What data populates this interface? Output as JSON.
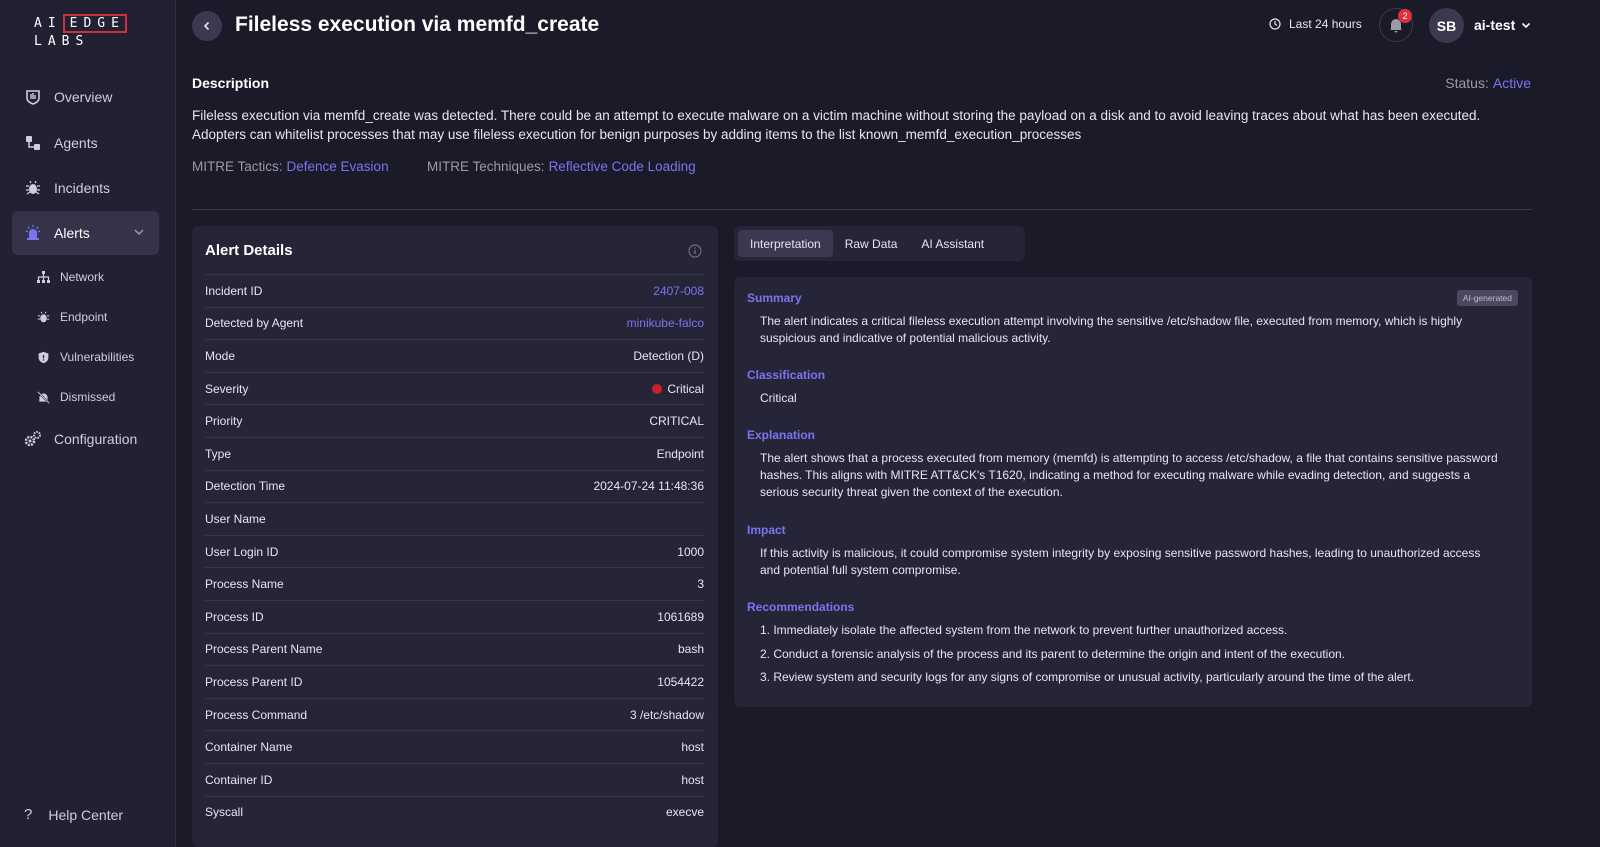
{
  "logo": {
    "top_left": "AI",
    "top_box": "EDGE",
    "bottom": "LABS"
  },
  "sidebar": {
    "items": [
      {
        "label": "Overview"
      },
      {
        "label": "Agents"
      },
      {
        "label": "Incidents"
      },
      {
        "label": "Alerts"
      },
      {
        "label": "Configuration"
      }
    ],
    "sub_items": [
      {
        "label": "Network"
      },
      {
        "label": "Endpoint"
      },
      {
        "label": "Vulnerabilities"
      },
      {
        "label": "Dismissed"
      }
    ],
    "help": "Help Center"
  },
  "header": {
    "title": "Fileless execution via memfd_create",
    "time_range": "Last 24 hours",
    "notif_count": "2",
    "avatar": "SB",
    "user": "ai-test"
  },
  "description": {
    "heading": "Description",
    "status_label": "Status:",
    "status_value": "Active",
    "text": "Fileless execution via memfd_create was detected. There could be an attempt to execute malware on a victim machine without storing the payload on a disk and to avoid leaving traces about what has been executed. Adopters can whitelist processes that may use fileless execution for benign purposes by adding items to the list known_memfd_execution_processes",
    "tactics_label": "MITRE Tactics:",
    "tactics_value": "Defence Evasion",
    "techniques_label": "MITRE Techniques:",
    "techniques_value": "Reflective Code Loading"
  },
  "alert_details": {
    "title": "Alert Details",
    "rows": [
      {
        "k": "Incident ID",
        "v": "2407-008"
      },
      {
        "k": "Detected by Agent",
        "v": "minikube-falco"
      },
      {
        "k": "Mode",
        "v": "Detection (D)"
      },
      {
        "k": "Severity",
        "v": "Critical"
      },
      {
        "k": "Priority",
        "v": "CRITICAL"
      },
      {
        "k": "Type",
        "v": "Endpoint"
      },
      {
        "k": "Detection Time",
        "v": "2024-07-24 11:48:36"
      },
      {
        "k": "User Name",
        "v": ""
      },
      {
        "k": "User Login ID",
        "v": "1000"
      },
      {
        "k": "Process Name",
        "v": "3"
      },
      {
        "k": "Process ID",
        "v": "1061689"
      },
      {
        "k": "Process Parent Name",
        "v": "bash"
      },
      {
        "k": "Process Parent ID",
        "v": "1054422"
      },
      {
        "k": "Process Command",
        "v": "3 /etc/shadow"
      },
      {
        "k": "Container Name",
        "v": "host"
      },
      {
        "k": "Container ID",
        "v": "host"
      },
      {
        "k": "Syscall",
        "v": "execve"
      }
    ]
  },
  "tabs": [
    {
      "label": "Interpretation"
    },
    {
      "label": "Raw Data"
    },
    {
      "label": "AI Assistant"
    }
  ],
  "interpretation": {
    "badge": "AI-generated",
    "summary_h": "Summary",
    "summary_t": "The alert indicates a critical fileless execution attempt involving the sensitive /etc/shadow file, executed from memory, which is highly suspicious and indicative of potential malicious activity.",
    "classification_h": "Classification",
    "classification_t": "Critical",
    "explanation_h": "Explanation",
    "explanation_t": "The alert shows that a process executed from memory (memfd) is attempting to access /etc/shadow, a file that contains sensitive password hashes. This aligns with MITRE ATT&CK's T1620, indicating a method for executing malware while evading detection, and suggests a serious security threat given the context of the execution.",
    "impact_h": "Impact",
    "impact_t": "If this activity is malicious, it could compromise system integrity by exposing sensitive password hashes, leading to unauthorized access and potential full system compromise.",
    "recommendations_h": "Recommendations",
    "rec": [
      "1. Immediately isolate the affected system from the network to prevent further unauthorized access.",
      "2. Conduct a forensic analysis of the process and its parent to determine the origin and intent of the execution.",
      "3. Review system and security logs for any signs of compromise or unusual activity, particularly around the time of the alert."
    ]
  },
  "colors": {
    "accent": "#7b74f0",
    "critical": "#c8202a",
    "background": "#1b1a29",
    "panel": "#262537"
  }
}
